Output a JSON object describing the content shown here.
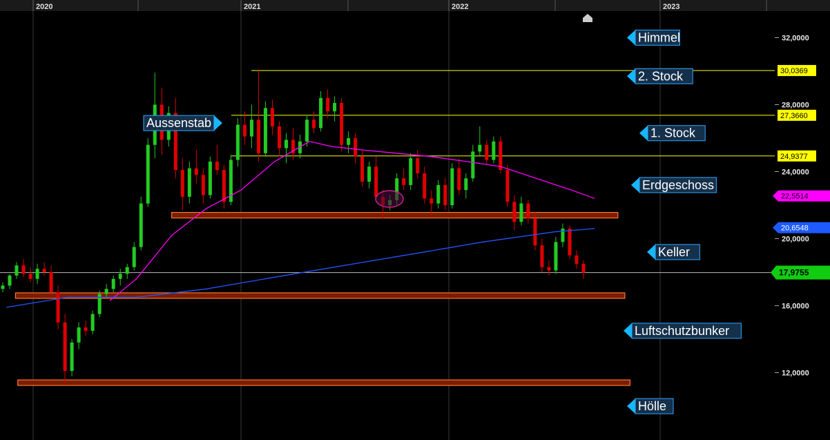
{
  "chart_data": {
    "type": "candlestick",
    "x_labels": [
      "2020",
      "2021",
      "2022",
      "2023"
    ],
    "y_ticks": [
      "32,0000",
      "28,0000",
      "24,0000",
      "20,0000",
      "16,0000",
      "12,0000"
    ],
    "y_tick_values": [
      32,
      28,
      24,
      20,
      16,
      12
    ],
    "price_tags": [
      {
        "label": "30,0369",
        "value": 30.0369,
        "bg": "#ffff00",
        "fg": "#000000",
        "kind": "line"
      },
      {
        "label": "27,3660",
        "value": 27.366,
        "bg": "#ffff00",
        "fg": "#000000",
        "kind": "line"
      },
      {
        "label": "24,9377",
        "value": 24.9377,
        "bg": "#ffff00",
        "fg": "#000000",
        "kind": "line"
      },
      {
        "label": "22,5514",
        "value": 22.5514,
        "bg": "#ff00ff",
        "fg": "#000000",
        "kind": "ma50"
      },
      {
        "label": "20,6548",
        "value": 20.6548,
        "bg": "#1e5bff",
        "fg": "#ffffff",
        "kind": "ma200"
      },
      {
        "label": "17,9755",
        "value": 17.9755,
        "bg": "#11cc11",
        "fg": "#000000",
        "kind": "last",
        "bold": true
      }
    ],
    "level_labels": [
      {
        "text": "Himmel",
        "value": 32.0
      },
      {
        "text": "2. Stock",
        "value": 29.7
      },
      {
        "text": "Aussenstab",
        "value": 26.9
      },
      {
        "text": "1. Stock",
        "value": 26.3
      },
      {
        "text": "Erdgeschoss",
        "value": 23.2
      },
      {
        "text": "Keller",
        "value": 19.2
      },
      {
        "text": "Luftschutzbunker",
        "value": 14.5
      },
      {
        "text": "Hölle",
        "value": 10.0
      }
    ],
    "zones": [
      {
        "date_start": "2020-09-01",
        "date_end": "2022-10-20",
        "value": 21.4
      },
      {
        "date_start": "2019-12-01",
        "date_end": "2022-11-01",
        "value": 16.6
      },
      {
        "date_start": "2019-12-05",
        "date_end": "2022-11-10",
        "value": 11.4
      }
    ],
    "series": [
      {
        "name": "",
        "color": "#ff00ff",
        "points": [
          [
            "2020-05-15",
            16.3
          ],
          [
            "2020-07-01",
            17.6
          ],
          [
            "2020-09-01",
            20.2
          ],
          [
            "2020-11-01",
            21.8
          ],
          [
            "2021-01-01",
            22.9
          ],
          [
            "2021-03-01",
            24.6
          ],
          [
            "2021-05-01",
            25.8
          ],
          [
            "2021-06-10",
            25.5
          ],
          [
            "2021-08-01",
            25.3
          ],
          [
            "2021-10-01",
            25.1
          ],
          [
            "2021-12-01",
            24.9
          ],
          [
            "2022-02-01",
            24.6
          ],
          [
            "2022-04-01",
            24.3
          ],
          [
            "2022-06-01",
            23.6
          ],
          [
            "2022-08-01",
            22.9
          ],
          [
            "2022-09-10",
            22.4
          ]
        ]
      },
      {
        "name": "",
        "color": "#2255ff",
        "points": [
          [
            "2019-11-15",
            15.9
          ],
          [
            "2020-03-01",
            16.5
          ],
          [
            "2020-07-01",
            16.5
          ],
          [
            "2020-11-01",
            17.0
          ],
          [
            "2021-03-01",
            17.7
          ],
          [
            "2021-07-01",
            18.4
          ],
          [
            "2021-11-01",
            19.1
          ],
          [
            "2022-03-01",
            19.8
          ],
          [
            "2022-07-01",
            20.4
          ],
          [
            "2022-09-10",
            20.6
          ]
        ]
      }
    ],
    "candles_ohlc_generated": [
      [
        17.0,
        17.4,
        16.8,
        17.2
      ],
      [
        17.2,
        17.9,
        17.0,
        17.8
      ],
      [
        17.8,
        18.6,
        17.6,
        18.4
      ],
      [
        18.4,
        18.8,
        17.7,
        17.9
      ],
      [
        17.9,
        18.3,
        17.4,
        17.6
      ],
      [
        17.6,
        18.5,
        17.3,
        18.2
      ],
      [
        18.2,
        18.6,
        17.8,
        18.0
      ],
      [
        18.0,
        18.4,
        16.5,
        16.8
      ],
      [
        16.8,
        17.2,
        14.6,
        15.0
      ],
      [
        15.0,
        15.5,
        11.3,
        12.1
      ],
      [
        12.1,
        14.0,
        11.8,
        13.8
      ],
      [
        13.8,
        15.0,
        13.4,
        14.7
      ],
      [
        14.7,
        15.1,
        14.2,
        14.5
      ],
      [
        14.5,
        15.7,
        14.3,
        15.5
      ],
      [
        15.5,
        16.9,
        15.3,
        16.7
      ],
      [
        16.7,
        17.3,
        16.5,
        17.0
      ],
      [
        17.0,
        17.8,
        16.8,
        17.6
      ],
      [
        17.6,
        18.2,
        17.2,
        17.9
      ],
      [
        17.9,
        18.5,
        17.6,
        18.3
      ],
      [
        18.3,
        19.8,
        18.1,
        19.5
      ],
      [
        19.5,
        22.5,
        19.3,
        22.1
      ],
      [
        22.1,
        26.0,
        21.9,
        25.6
      ],
      [
        25.6,
        29.9,
        24.8,
        28.0
      ],
      [
        28.0,
        29.0,
        25.0,
        25.9
      ],
      [
        25.9,
        27.9,
        25.5,
        27.5
      ],
      [
        27.5,
        28.4,
        23.6,
        24.1
      ],
      [
        24.1,
        24.8,
        21.7,
        22.5
      ],
      [
        22.5,
        24.6,
        22.1,
        24.2
      ],
      [
        24.2,
        25.3,
        23.3,
        23.8
      ],
      [
        23.8,
        24.2,
        22.1,
        22.6
      ],
      [
        22.6,
        24.9,
        22.4,
        24.6
      ],
      [
        24.6,
        25.6,
        23.8,
        24.1
      ],
      [
        24.1,
        24.4,
        21.8,
        22.2
      ],
      [
        22.2,
        25.0,
        22.0,
        24.7
      ],
      [
        24.7,
        27.2,
        24.3,
        26.8
      ],
      [
        26.8,
        27.6,
        25.6,
        26.1
      ],
      [
        26.1,
        28.0,
        25.4,
        27.1
      ],
      [
        27.1,
        30.1,
        24.6,
        25.1
      ],
      [
        25.1,
        28.2,
        24.9,
        27.8
      ],
      [
        27.8,
        28.3,
        26.2,
        26.7
      ],
      [
        26.7,
        27.0,
        24.9,
        25.4
      ],
      [
        25.4,
        26.3,
        24.5,
        25.9
      ],
      [
        25.9,
        26.6,
        24.7,
        25.1
      ],
      [
        25.1,
        26.2,
        24.8,
        25.8
      ],
      [
        25.8,
        27.4,
        25.5,
        27.1
      ],
      [
        27.1,
        27.6,
        26.3,
        26.6
      ],
      [
        26.6,
        28.8,
        26.4,
        28.4
      ],
      [
        28.4,
        28.9,
        27.2,
        27.6
      ],
      [
        27.6,
        28.5,
        27.0,
        28.1
      ],
      [
        28.1,
        28.4,
        25.2,
        25.6
      ],
      [
        25.6,
        26.4,
        25.1,
        26.0
      ],
      [
        26.0,
        26.3,
        24.5,
        24.9
      ],
      [
        24.9,
        25.3,
        23.1,
        23.4
      ],
      [
        23.4,
        24.6,
        23.0,
        24.3
      ],
      [
        24.3,
        24.9,
        22.2,
        22.5
      ],
      [
        22.5,
        22.9,
        21.2,
        22.0
      ],
      [
        22.0,
        22.6,
        21.7,
        22.3
      ],
      [
        22.3,
        23.9,
        22.0,
        23.6
      ],
      [
        23.6,
        24.2,
        22.9,
        23.2
      ],
      [
        23.2,
        25.1,
        22.9,
        24.8
      ],
      [
        24.8,
        25.3,
        23.6,
        23.9
      ],
      [
        23.9,
        24.3,
        22.1,
        22.4
      ],
      [
        22.4,
        22.9,
        21.4,
        22.1
      ],
      [
        22.1,
        23.5,
        21.8,
        23.2
      ],
      [
        23.2,
        23.6,
        21.7,
        22.0
      ],
      [
        22.0,
        24.5,
        21.8,
        24.2
      ],
      [
        24.2,
        24.8,
        22.6,
        22.9
      ],
      [
        22.9,
        23.9,
        22.4,
        23.6
      ],
      [
        23.6,
        25.6,
        23.4,
        25.2
      ],
      [
        25.2,
        26.7,
        24.9,
        25.6
      ],
      [
        25.6,
        25.9,
        24.4,
        24.7
      ],
      [
        24.7,
        26.1,
        24.5,
        25.8
      ],
      [
        25.8,
        26.1,
        23.9,
        24.1
      ],
      [
        24.1,
        24.4,
        21.9,
        22.2
      ],
      [
        22.2,
        22.6,
        20.5,
        21.0
      ],
      [
        21.0,
        22.5,
        20.8,
        22.1
      ],
      [
        22.1,
        22.3,
        20.9,
        21.2
      ],
      [
        21.2,
        21.6,
        19.3,
        19.6
      ],
      [
        19.6,
        20.0,
        18.0,
        18.3
      ],
      [
        18.3,
        18.7,
        17.8,
        18.1
      ],
      [
        18.1,
        20.1,
        17.9,
        19.8
      ],
      [
        19.8,
        20.9,
        19.5,
        20.6
      ],
      [
        20.6,
        20.8,
        18.8,
        19.0
      ],
      [
        19.0,
        19.3,
        18.2,
        18.5
      ],
      [
        18.5,
        18.7,
        17.6,
        17.97
      ]
    ]
  },
  "colors": {
    "bull": "#22cc22",
    "bear": "#e00000",
    "hline": "#ffff00",
    "zone_fill": "#7a1d00",
    "zone_stroke": "#ff7733",
    "label_bg": "#15304a",
    "label_border": "#2fa8ff",
    "arrow": "#17b7ff",
    "grid": "#3a3a3a",
    "ellipse": "#cc2288"
  }
}
